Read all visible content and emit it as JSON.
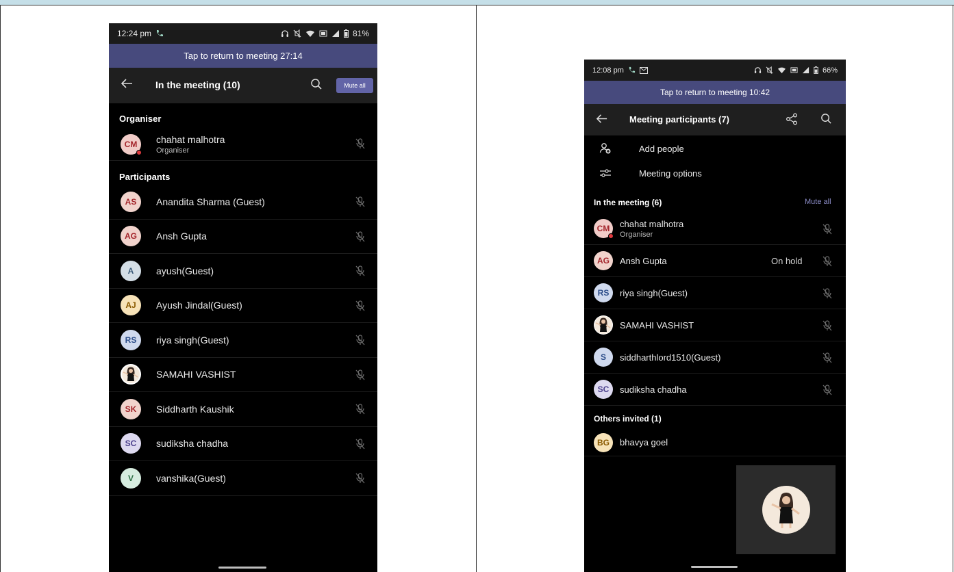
{
  "left_phone": {
    "status": {
      "time": "12:24 pm",
      "battery": "81%"
    },
    "banner": "Tap to return to meeting 27:14",
    "header": {
      "title": "In the meeting (10)",
      "mute_all": "Mute all"
    },
    "organiser_section": "Organiser",
    "organiser": {
      "initials": "CM",
      "name": "chahat malhotra",
      "role": "Organiser",
      "color": "#f1ccc8",
      "text_color": "#a4262c"
    },
    "participants_section": "Participants",
    "participants": [
      {
        "initials": "AS",
        "name": "Anandita Sharma (Guest)",
        "color": "#f1d3cc",
        "text_color": "#a4262c"
      },
      {
        "initials": "AG",
        "name": "Ansh Gupta",
        "color": "#f1d3cc",
        "text_color": "#a4262c"
      },
      {
        "initials": "A",
        "name": "ayush(Guest)",
        "color": "#d4dee6",
        "text_color": "#3a5a78"
      },
      {
        "initials": "AJ",
        "name": "Ayush Jindal(Guest)",
        "color": "#f7e3b8",
        "text_color": "#8a5a00"
      },
      {
        "initials": "RS",
        "name": "riya singh(Guest)",
        "color": "#cfd9ee",
        "text_color": "#2d4e8a"
      },
      {
        "initials": "",
        "name": "SAMAHI VASHIST",
        "color": "#ffffff",
        "text_color": "#000000"
      },
      {
        "initials": "SK",
        "name": "Siddharth Kaushik",
        "color": "#f1d3cc",
        "text_color": "#a4262c"
      },
      {
        "initials": "SC",
        "name": "sudiksha chadha",
        "color": "#ddd9f0",
        "text_color": "#4b3f8c"
      },
      {
        "initials": "V",
        "name": "vanshika(Guest)",
        "color": "#d6ecdf",
        "text_color": "#2d6f45"
      }
    ]
  },
  "right_phone": {
    "status": {
      "time": "12:08 pm",
      "battery": "66%"
    },
    "banner": "Tap to return to meeting 10:42",
    "header": {
      "title": "Meeting participants (7)"
    },
    "actions": [
      {
        "label": "Add people",
        "icon": "add-people-icon"
      },
      {
        "label": "Meeting options",
        "icon": "settings-sliders-icon"
      }
    ],
    "in_meeting_section": "In the meeting (6)",
    "mute_all": "Mute all",
    "in_meeting": [
      {
        "initials": "CM",
        "name": "chahat malhotra",
        "role": "Organiser",
        "status": "",
        "color": "#f1ccc8",
        "text_color": "#a4262c",
        "dot": true
      },
      {
        "initials": "AG",
        "name": "Ansh Gupta",
        "role": "",
        "status": "On hold",
        "color": "#f1d3cc",
        "text_color": "#a4262c",
        "dot": false
      },
      {
        "initials": "RS",
        "name": "riya singh(Guest)",
        "role": "",
        "status": "",
        "color": "#cfd9ee",
        "text_color": "#2d4e8a",
        "dot": false
      },
      {
        "initials": "",
        "name": "SAMAHI VASHIST",
        "role": "",
        "status": "",
        "color": "#ffffff",
        "text_color": "#000000",
        "dot": false
      },
      {
        "initials": "S",
        "name": "siddharthlord1510(Guest)",
        "role": "",
        "status": "",
        "color": "#cfd9ee",
        "text_color": "#2d4e8a",
        "dot": false
      },
      {
        "initials": "SC",
        "name": "sudiksha chadha",
        "role": "",
        "status": "",
        "color": "#ddd9f0",
        "text_color": "#4b3f8c",
        "dot": false
      }
    ],
    "others_section": "Others invited (1)",
    "others": [
      {
        "initials": "BG",
        "name": "bhavya goel",
        "color": "#f7e3b8",
        "text_color": "#8a5a00"
      }
    ]
  }
}
